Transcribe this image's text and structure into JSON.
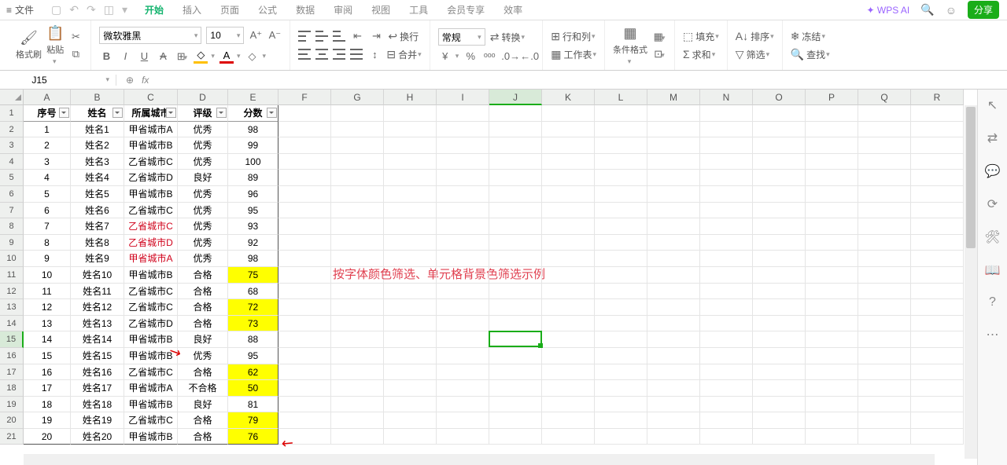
{
  "topbar": {
    "file": "文件",
    "tabs": [
      "开始",
      "插入",
      "页面",
      "公式",
      "数据",
      "审阅",
      "视图",
      "工具",
      "会员专享",
      "效率"
    ],
    "active_tab": 0,
    "wpsai": "WPS AI",
    "share": "分享"
  },
  "ribbon": {
    "format_painter": "格式刷",
    "paste": "粘贴",
    "font_name": "微软雅黑",
    "font_size": "10",
    "number_format": "常规",
    "wrap": "换行",
    "merge": "合并",
    "convert": "转换",
    "rowcol": "行和列",
    "worksheet": "工作表",
    "cond_format": "条件格式",
    "fill": "填充",
    "sum": "求和",
    "sort": "排序",
    "freeze": "冻结",
    "filter": "筛选",
    "find": "查找"
  },
  "namebox": "J15",
  "fx": "fx",
  "columns": [
    "A",
    "B",
    "C",
    "D",
    "E",
    "F",
    "G",
    "H",
    "I",
    "J",
    "K",
    "L",
    "M",
    "N",
    "O",
    "P",
    "Q",
    "R"
  ],
  "headers": [
    "序号",
    "姓名",
    "所属城市",
    "评级",
    "分数"
  ],
  "rows": [
    {
      "n": 1,
      "name": "姓名1",
      "city": "甲省城市A",
      "rate": "优秀",
      "score": 98
    },
    {
      "n": 2,
      "name": "姓名2",
      "city": "甲省城市B",
      "rate": "优秀",
      "score": 99
    },
    {
      "n": 3,
      "name": "姓名3",
      "city": "乙省城市C",
      "rate": "优秀",
      "score": 100
    },
    {
      "n": 4,
      "name": "姓名4",
      "city": "乙省城市D",
      "rate": "良好",
      "score": 89
    },
    {
      "n": 5,
      "name": "姓名5",
      "city": "甲省城市B",
      "rate": "优秀",
      "score": 96
    },
    {
      "n": 6,
      "name": "姓名6",
      "city": "乙省城市C",
      "rate": "优秀",
      "score": 95
    },
    {
      "n": 7,
      "name": "姓名7",
      "city": "乙省城市C",
      "rate": "优秀",
      "score": 93,
      "red": true
    },
    {
      "n": 8,
      "name": "姓名8",
      "city": "乙省城市D",
      "rate": "优秀",
      "score": 92,
      "red": true
    },
    {
      "n": 9,
      "name": "姓名9",
      "city": "甲省城市A",
      "rate": "优秀",
      "score": 98,
      "red": true
    },
    {
      "n": 10,
      "name": "姓名10",
      "city": "甲省城市B",
      "rate": "合格",
      "score": 75,
      "yl": true
    },
    {
      "n": 11,
      "name": "姓名11",
      "city": "乙省城市C",
      "rate": "合格",
      "score": 68
    },
    {
      "n": 12,
      "name": "姓名12",
      "city": "乙省城市C",
      "rate": "合格",
      "score": 72,
      "yl": true
    },
    {
      "n": 13,
      "name": "姓名13",
      "city": "乙省城市D",
      "rate": "合格",
      "score": 73,
      "yl": true
    },
    {
      "n": 14,
      "name": "姓名14",
      "city": "甲省城市B",
      "rate": "良好",
      "score": 88
    },
    {
      "n": 15,
      "name": "姓名15",
      "city": "甲省城市B",
      "rate": "优秀",
      "score": 95
    },
    {
      "n": 16,
      "name": "姓名16",
      "city": "乙省城市C",
      "rate": "合格",
      "score": 62,
      "yl": true
    },
    {
      "n": 17,
      "name": "姓名17",
      "city": "甲省城市A",
      "rate": "不合格",
      "score": 50,
      "yl": true
    },
    {
      "n": 18,
      "name": "姓名18",
      "city": "甲省城市B",
      "rate": "良好",
      "score": 81
    },
    {
      "n": 19,
      "name": "姓名19",
      "city": "乙省城市C",
      "rate": "合格",
      "score": 79,
      "yl": true
    },
    {
      "n": 20,
      "name": "姓名20",
      "city": "甲省城市B",
      "rate": "合格",
      "score": 76,
      "yl": true
    }
  ],
  "note": "按字体颜色筛选、单元格背景色筛选示例",
  "selected_cell": {
    "col": "J",
    "row": 15
  }
}
